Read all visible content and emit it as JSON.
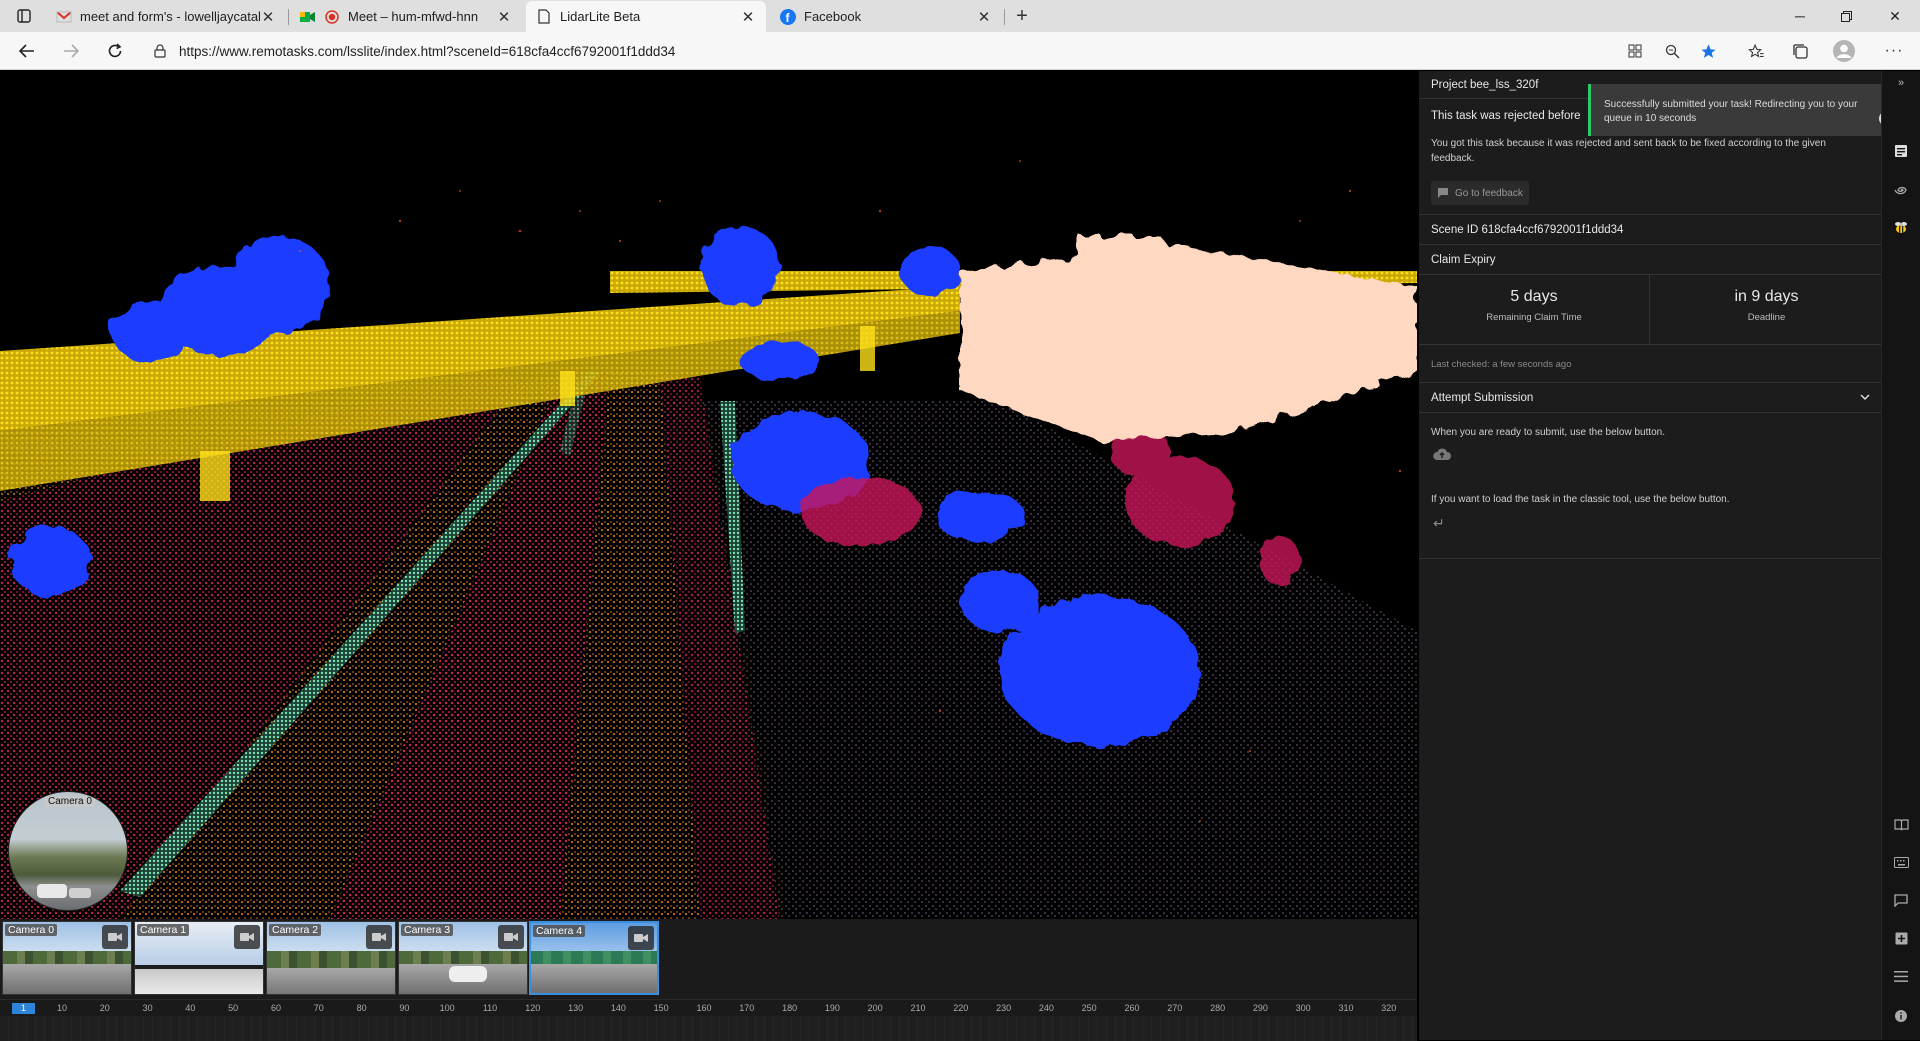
{
  "browser": {
    "tabs": [
      {
        "title": "meet and form's - lowelljaycatalan",
        "icon": "gmail-icon"
      },
      {
        "title": "Meet – hum-mfwd-hnn",
        "icon": "meet-icon"
      },
      {
        "title": "LidarLite Beta",
        "icon": "page-icon"
      },
      {
        "title": "Facebook",
        "icon": "facebook-icon"
      }
    ],
    "url": "https://www.remotasks.com/lsslite/index.html?sceneId=618cfa4ccf6792001f1ddd34"
  },
  "panel": {
    "project": "Project bee_lss_320f",
    "rejected": "This task was rejected before",
    "rejected_desc": "You got this task because it was rejected and sent back to be fixed according to the given feedback.",
    "go_feedback": "Go to feedback",
    "scene_id": "Scene ID 618cfa4ccf6792001f1ddd34",
    "claim_expiry": "Claim Expiry",
    "remaining_value": "5 days",
    "remaining_label": "Remaining Claim Time",
    "deadline_value": "in 9 days",
    "deadline_label": "Deadline",
    "last_checked": "Last checked: a few seconds ago",
    "attempt": "Attempt Submission",
    "submit_desc": "When you are ready to submit, use the below button.",
    "classic_desc": "If you want to load the task in the classic tool, use the below button."
  },
  "toast": {
    "message": "Successfully submitted your task! Redirecting you to your queue in 10 seconds"
  },
  "cameras": {
    "circle_label": "Camera 0",
    "thumbs": [
      "Camera 0",
      "Camera 1",
      "Camera 2",
      "Camera 3",
      "Camera 4"
    ],
    "selected": 4
  },
  "timeline": {
    "current": "1",
    "ticks": [
      "10",
      "20",
      "30",
      "40",
      "50",
      "60",
      "70",
      "80",
      "90",
      "100",
      "110",
      "120",
      "130",
      "140",
      "150",
      "160",
      "170",
      "180",
      "190",
      "200",
      "210",
      "220",
      "230",
      "240",
      "250",
      "260",
      "270",
      "280",
      "290",
      "300",
      "310",
      "320"
    ]
  },
  "colors": {
    "accent": "#2d84d8",
    "success": "#2ec866",
    "ground": "#e0245e",
    "lane": "#d97f1e",
    "vegetation": "#1a3dff",
    "bridge": "#f5d10a",
    "building": "#ffd8c2",
    "curb": "#7ae0b0"
  }
}
